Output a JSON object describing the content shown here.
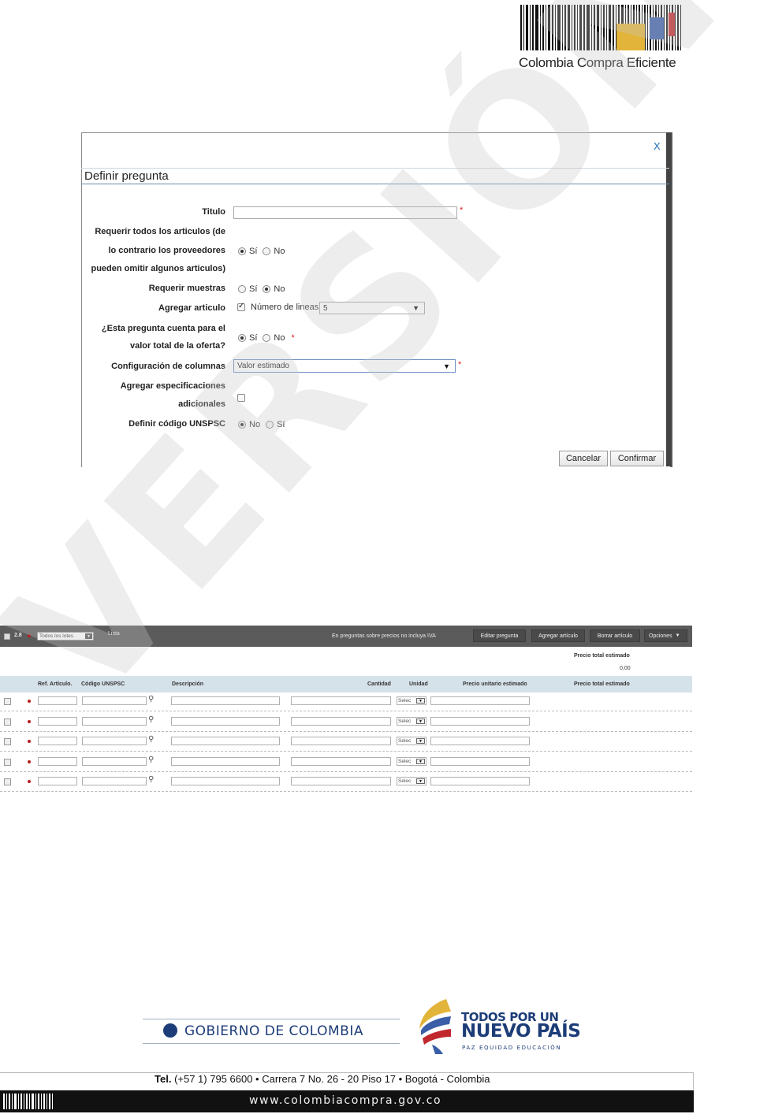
{
  "header": {
    "logo_text": "Colombia Compra Eficiente"
  },
  "watermark": {
    "text": "VERSIÓN PRELIMINAR"
  },
  "dialog": {
    "close_label": "X",
    "title": "Definir pregunta",
    "titulo": {
      "label": "Titulo",
      "value": ""
    },
    "requerir_articulos": {
      "label_line1": "Requerir todos los articulos (de",
      "label_line2": "lo contrario los proveedores",
      "label_line3": "pueden omitir algunos articulos)",
      "opt_si": "Sí",
      "opt_no": "No",
      "selected": "si"
    },
    "requerir_muestras": {
      "label": "Requerir muestras",
      "opt_si": "Sí",
      "opt_no": "No",
      "selected": "no"
    },
    "agregar_articulo": {
      "label": "Agregar articulo",
      "checked": true,
      "lineas_label": "Número de lineas",
      "lineas_value": "5"
    },
    "cuenta_valor": {
      "label_line1": "¿Esta pregunta cuenta para el",
      "label_line2": "valor total de la oferta?",
      "opt_si": "Sí",
      "opt_no": "No",
      "selected": "si"
    },
    "config_columnas": {
      "label": "Configuración de columnas",
      "value": "Valor estimado"
    },
    "especificaciones": {
      "label_line1": "Agregar especificaciones",
      "label_line2": "adicionales",
      "checked": false
    },
    "unspsc": {
      "label": "Definir código UNSPSC",
      "opt_no": "No",
      "opt_si": "Sí",
      "selected": "no"
    },
    "required_mark": "*",
    "cancel_label": "Cancelar",
    "confirm_label": "Confirmar"
  },
  "table": {
    "toolbar": {
      "item_number": "2.8",
      "lote_select": "Todos los lotes",
      "lista_label": "Lista",
      "iva_note": "En preguntas sobre precios no incluya IVA",
      "edit_label": "Editar pregunta",
      "add_label": "Agregar artículo",
      "delete_label": "Borrar artículo",
      "options_label": "Opciones"
    },
    "total_label": "Precio total estimado",
    "total_value": "0,00",
    "columns": {
      "ref": "Ref. Artículo.",
      "unspsc": "Código UNSPSC",
      "descripcion": "Descripción",
      "cantidad": "Cantidad",
      "unidad": "Unidad",
      "precio_unitario": "Precio unitario estimado",
      "precio_total": "Precio total estimado"
    },
    "unit_placeholder": "Selec",
    "row_count": 5
  },
  "footer": {
    "gobierno": "GOBIERNO DE COLOMBIA",
    "todos_line1": "TODOS POR UN",
    "todos_line2": "NUEVO PAÍS",
    "todos_line3": "PAZ EQUIDAD EDUCACIÓN",
    "contact_bold": "Tel.",
    "contact_rest": "(+57 1) 795 6600 • Carrera 7 No. 26 - 20 Piso 17 • Bogotá - Colombia",
    "url": "www.colombiacompra.gov.co"
  },
  "colors": {
    "brand_yellow": "#e2b43a",
    "brand_blue": "#3a5ea8",
    "brand_red": "#c0282e",
    "toolbar": "#5b5b5b",
    "header_row": "#d6e2ea"
  }
}
